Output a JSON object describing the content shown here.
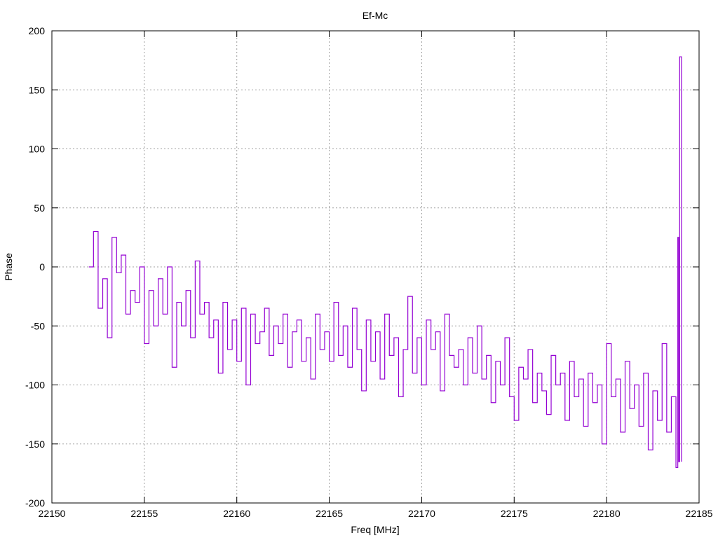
{
  "chart_data": {
    "type": "line",
    "title": "Ef-Mc",
    "xlabel": "Freq [MHz]",
    "ylabel": "Phase",
    "xlim": [
      22150,
      22185
    ],
    "ylim": [
      -200,
      200
    ],
    "xticks": [
      "22150",
      "22155",
      "22160",
      "22165",
      "22170",
      "22175",
      "22180",
      "22185"
    ],
    "yticks": [
      "200",
      "150",
      "100",
      "50",
      "0",
      "-50",
      "-100",
      "-150",
      "-200"
    ],
    "grid": true,
    "color": "#9400d3",
    "series": [
      {
        "name": "Ef-Mc",
        "x": [
          22152,
          22152.25,
          22152.5,
          22152.75,
          22153,
          22153.25,
          22153.5,
          22153.75,
          22154,
          22154.25,
          22154.5,
          22154.75,
          22155,
          22155.25,
          22155.5,
          22155.75,
          22156,
          22156.25,
          22156.5,
          22156.75,
          22157,
          22157.25,
          22157.5,
          22157.75,
          22158,
          22158.25,
          22158.5,
          22158.75,
          22159,
          22159.25,
          22159.5,
          22159.75,
          22160,
          22160.25,
          22160.5,
          22160.75,
          22161,
          22161.25,
          22161.5,
          22161.75,
          22162,
          22162.25,
          22162.5,
          22162.75,
          22163,
          22163.25,
          22163.5,
          22163.75,
          22164,
          22164.25,
          22164.5,
          22164.75,
          22165,
          22165.25,
          22165.5,
          22165.75,
          22166,
          22166.25,
          22166.5,
          22166.75,
          22167,
          22167.25,
          22167.5,
          22167.75,
          22168,
          22168.25,
          22168.5,
          22168.75,
          22169,
          22169.25,
          22169.5,
          22169.75,
          22170,
          22170.25,
          22170.5,
          22170.75,
          22171,
          22171.25,
          22171.5,
          22171.75,
          22172,
          22172.25,
          22172.5,
          22172.75,
          22173,
          22173.25,
          22173.5,
          22173.75,
          22174,
          22174.25,
          22174.5,
          22174.75,
          22175,
          22175.25,
          22175.5,
          22175.75,
          22176,
          22176.25,
          22176.5,
          22176.75,
          22177,
          22177.25,
          22177.5,
          22177.75,
          22178,
          22178.25,
          22178.5,
          22178.75,
          22179,
          22179.25,
          22179.5,
          22179.75,
          22180,
          22180.25,
          22180.5,
          22180.75,
          22181,
          22181.25,
          22181.5,
          22181.75,
          22182,
          22182.25,
          22182.5,
          22182.75,
          22183,
          22183.25,
          22183.5,
          22183.75,
          22183.85,
          22183.9,
          22183.95,
          22184.05
        ],
        "y": [
          0,
          30,
          -35,
          -10,
          -60,
          25,
          -5,
          10,
          -40,
          -20,
          -30,
          0,
          -65,
          -20,
          -50,
          -10,
          -40,
          0,
          -85,
          -30,
          -50,
          -20,
          -60,
          5,
          -40,
          -30,
          -60,
          -45,
          -90,
          -30,
          -70,
          -45,
          -80,
          -35,
          -100,
          -40,
          -65,
          -55,
          -35,
          -75,
          -50,
          -65,
          -40,
          -85,
          -55,
          -45,
          -80,
          -60,
          -95,
          -40,
          -70,
          -55,
          -80,
          -30,
          -75,
          -50,
          -85,
          -35,
          -70,
          -105,
          -45,
          -80,
          -55,
          -95,
          -40,
          -75,
          -60,
          -110,
          -70,
          -25,
          -90,
          -60,
          -100,
          -45,
          -70,
          -55,
          -105,
          -40,
          -75,
          -85,
          -70,
          -100,
          -60,
          -90,
          -50,
          -95,
          -75,
          -115,
          -80,
          -100,
          -60,
          -110,
          -130,
          -85,
          -95,
          -70,
          -115,
          -90,
          -105,
          -125,
          -75,
          -100,
          -90,
          -130,
          -80,
          -110,
          -95,
          -135,
          -90,
          -115,
          -100,
          -150,
          -65,
          -110,
          -95,
          -140,
          -80,
          -120,
          -100,
          -135,
          -90,
          -155,
          -105,
          -130,
          -65,
          -140,
          -110,
          -170,
          25,
          -165,
          178,
          -165
        ]
      }
    ]
  }
}
